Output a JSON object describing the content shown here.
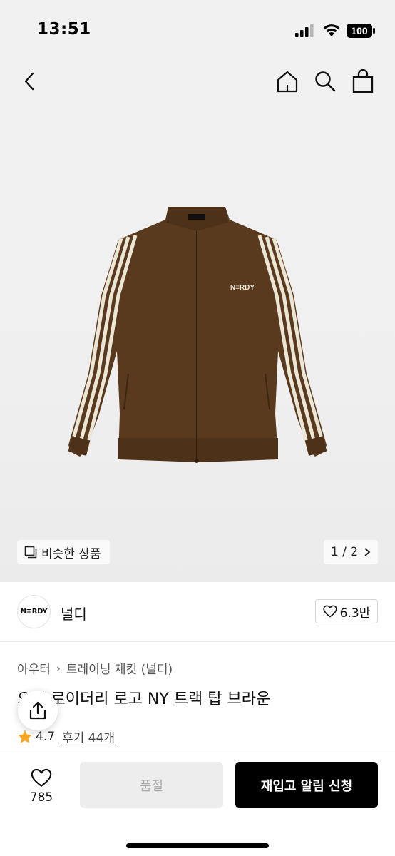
{
  "status_bar": {
    "time": "13:51",
    "battery": "100"
  },
  "image": {
    "similar_label": "비슷한 상품",
    "pager": "1/2",
    "pager_current": "1",
    "pager_total": "2",
    "jacket_logo": "N≡RDY"
  },
  "brand": {
    "logo_text": "N≡RDY",
    "name": "널디",
    "like_count": "6.3만"
  },
  "breadcrumb": [
    "아우터",
    "트레이닝 재킷 (널디)"
  ],
  "product": {
    "title": "오버 로이더리 로고 NY 트랙 탑 브라운",
    "rating": "4.7",
    "review_label": "후기 44개"
  },
  "bottom": {
    "wish_count": "785",
    "soldout_label": "품절",
    "restock_label": "재입고 알림 신청"
  },
  "colors": {
    "jacket": "#5a3a1e",
    "stripe": "#ece6d6",
    "accent_star": "#f5a623",
    "primary_button": "#000000",
    "disabled_button": "#ededed"
  }
}
